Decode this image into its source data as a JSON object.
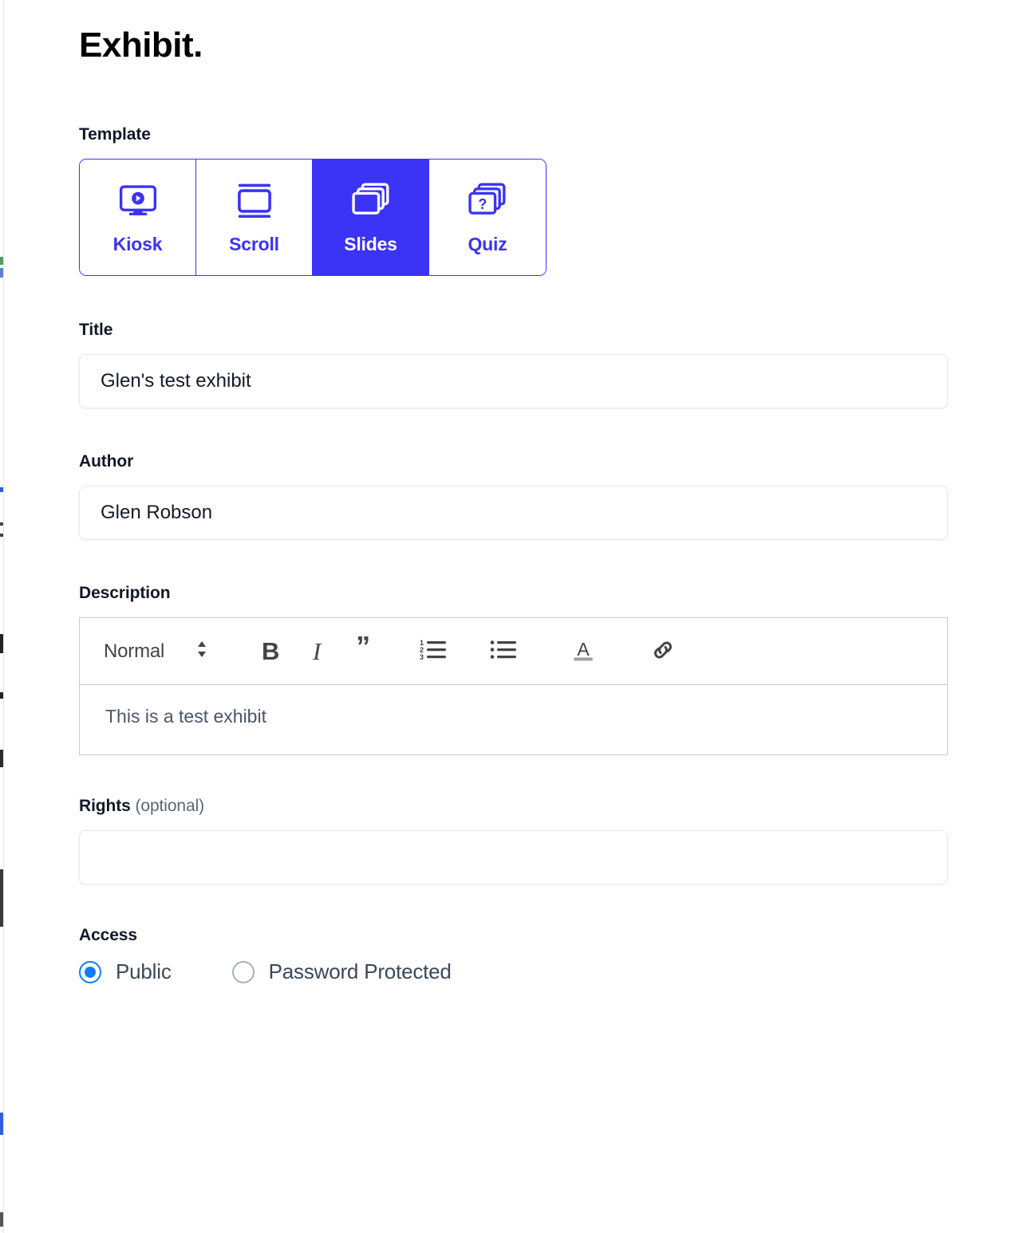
{
  "app": {
    "title": "Exhibit."
  },
  "template": {
    "label": "Template",
    "selected": "Slides",
    "accent_color": "#3b33f5",
    "options": [
      {
        "label": "Kiosk",
        "icon": "monitor-play-icon",
        "selected": false
      },
      {
        "label": "Scroll",
        "icon": "scroll-frame-icon",
        "selected": false
      },
      {
        "label": "Slides",
        "icon": "card-stack-icon",
        "selected": true
      },
      {
        "label": "Quiz",
        "icon": "card-stack-question-icon",
        "selected": false
      }
    ]
  },
  "title_field": {
    "label": "Title",
    "value": "Glen's test exhibit",
    "placeholder": ""
  },
  "author_field": {
    "label": "Author",
    "value": "Glen Robson",
    "placeholder": ""
  },
  "description_field": {
    "label": "Description",
    "body_text": "This is a test exhibit",
    "toolbar": {
      "format_name": "Normal",
      "stepper_icon": "up-down-arrows-icon",
      "bold_label": "B",
      "italic_label": "I",
      "blockquote_label": "”",
      "ordered_list_icon": "numbered-list-icon",
      "bullet_list_icon": "bullet-list-icon",
      "text_color_label": "A",
      "text_color_swatch": "#a0a0a0",
      "link_icon": "link-chain-icon"
    }
  },
  "rights_field": {
    "label": "Rights",
    "label_suffix": "(optional)",
    "value": "",
    "placeholder": ""
  },
  "access_field": {
    "label": "Access",
    "selected": "Public",
    "options": [
      {
        "label": "Public",
        "checked": true
      },
      {
        "label": "Password Protected",
        "checked": false
      }
    ],
    "checked_color": "#0d7ef5"
  }
}
